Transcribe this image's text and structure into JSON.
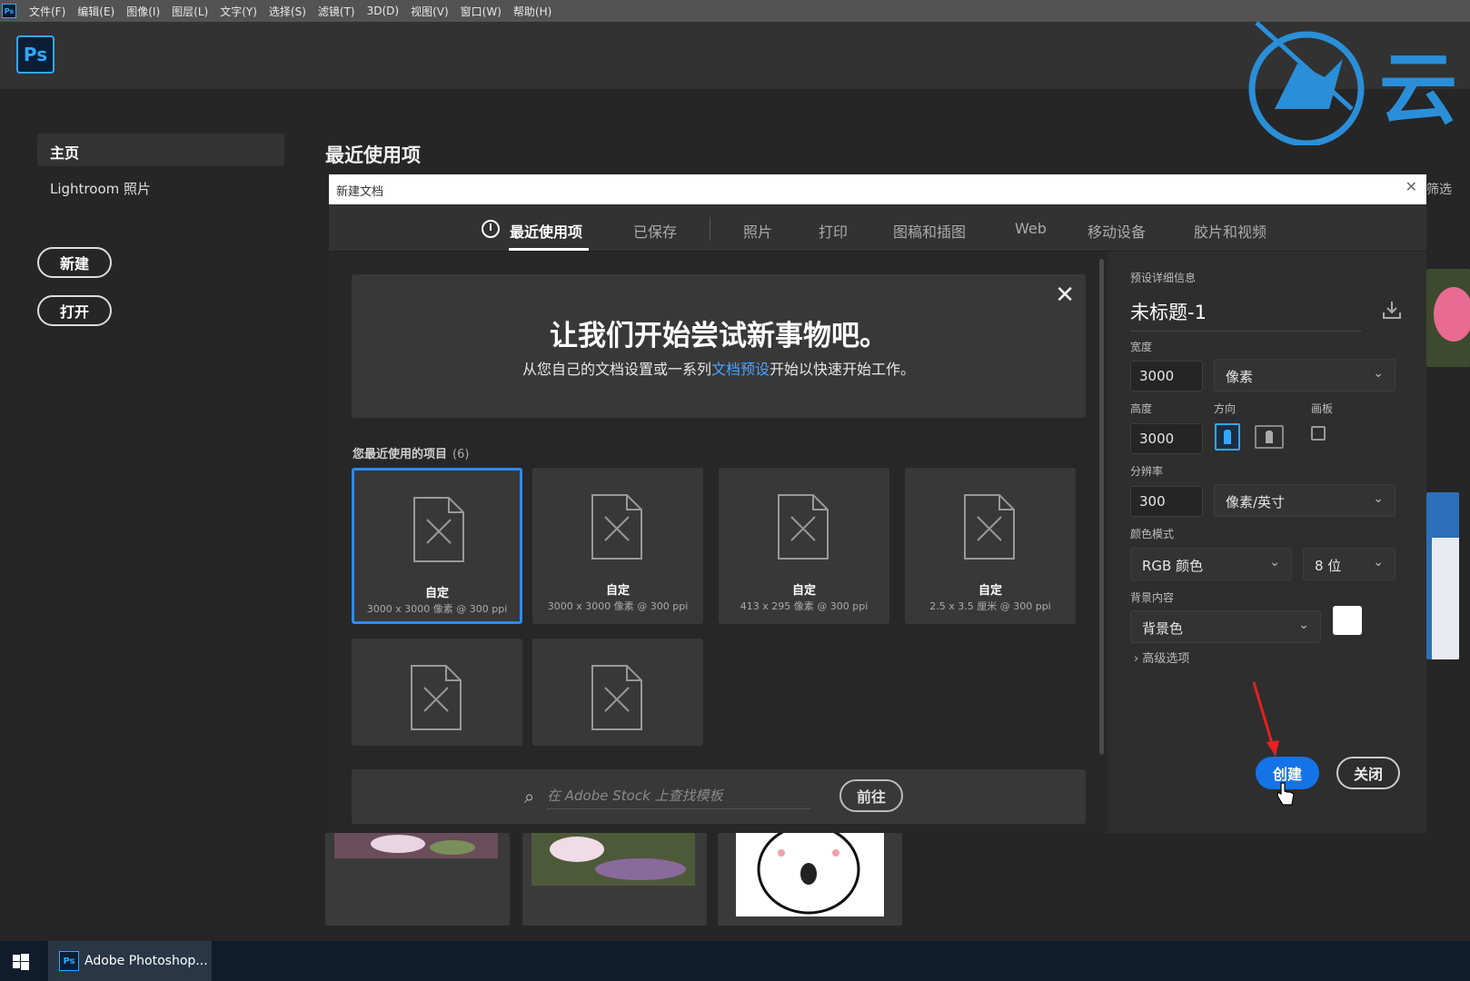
{
  "menubar": {
    "logo": "Ps",
    "items": [
      "文件(F)",
      "编辑(E)",
      "图像(I)",
      "图层(L)",
      "文字(Y)",
      "选择(S)",
      "滤镜(T)",
      "3D(D)",
      "视图(V)",
      "窗口(W)",
      "帮助(H)"
    ]
  },
  "app": {
    "logo": "Ps"
  },
  "watermark": {
    "text": "云"
  },
  "sidebar": {
    "home": "主页",
    "lightroom": "Lightroom 照片",
    "new_btn": "新建",
    "open_btn": "打开"
  },
  "home": {
    "recent_title": "最近使用项",
    "filter": "筛选"
  },
  "dialog": {
    "title": "新建文档",
    "tabs": [
      "最近使用项",
      "已保存",
      "照片",
      "打印",
      "图稿和插图",
      "Web",
      "移动设备",
      "胶片和视频"
    ],
    "banner": {
      "heading": "让我们开始尝试新事物吧。",
      "text_before": "从您自己的文档设置或一系列",
      "link": "文档预设",
      "text_after": "开始以快速开始工作。"
    },
    "recent_label": "您最近使用的项目",
    "recent_count": "(6)",
    "cards": [
      {
        "name": "自定",
        "dims": "3000 x 3000 像素 @ 300 ppi"
      },
      {
        "name": "自定",
        "dims": "3000 x 3000 像素 @ 300 ppi"
      },
      {
        "name": "自定",
        "dims": "413 x 295 像素 @ 300 ppi"
      },
      {
        "name": "自定",
        "dims": "2.5 x 3.5 厘米 @ 300 ppi"
      }
    ],
    "stock_placeholder": "在 Adobe Stock 上查找模板",
    "stock_go": "前往"
  },
  "preset": {
    "section_label": "预设详细信息",
    "name": "未标题-1",
    "width_label": "宽度",
    "width": "3000",
    "width_unit": "像素",
    "height_label": "高度",
    "height": "3000",
    "orientation_label": "方向",
    "artboard_label": "画板",
    "resolution_label": "分辨率",
    "resolution": "300",
    "resolution_unit": "像素/英寸",
    "color_mode_label": "颜色模式",
    "color_mode": "RGB 颜色",
    "bit_depth": "8 位",
    "background_label": "背景内容",
    "background": "背景色",
    "background_color": "#ffffff",
    "advanced": "高级选项",
    "create_btn": "创建",
    "close_btn": "关闭"
  },
  "taskbar": {
    "app_label": "Adobe Photoshop...",
    "app_icon": "Ps"
  },
  "colors": {
    "accent": "#1473e6",
    "ps_blue": "#31a8ff",
    "watermark": "#2a8fd8"
  }
}
